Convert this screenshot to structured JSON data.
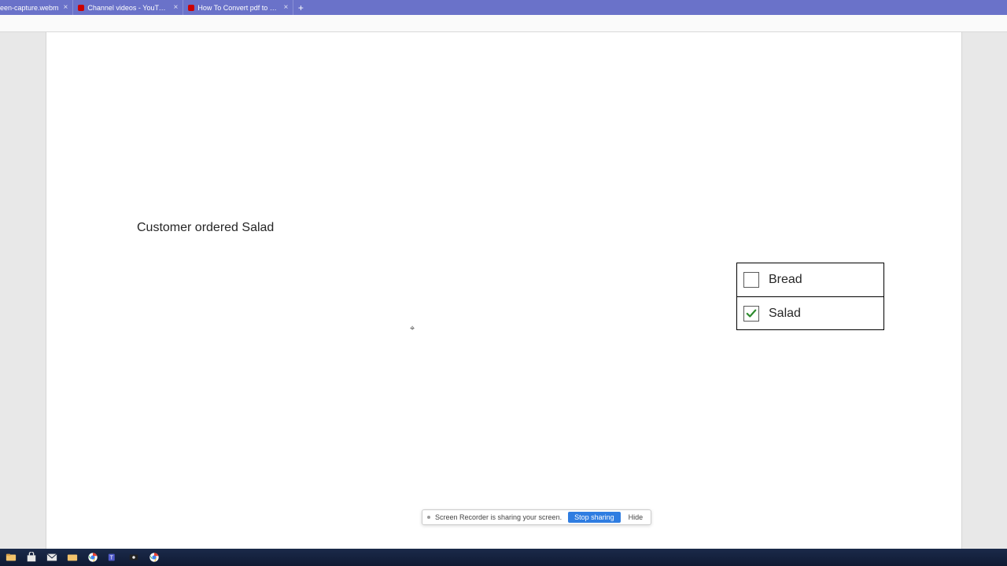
{
  "tabs": [
    {
      "label": "een-capture.webm",
      "has_favicon": false
    },
    {
      "label": "Channel videos - YouTube Studio",
      "has_favicon": true
    },
    {
      "label": "How To Convert pdf to word wit",
      "has_favicon": true
    }
  ],
  "document": {
    "body_text": "Customer ordered Salad",
    "choices": [
      {
        "label": "Bread",
        "checked": false
      },
      {
        "label": "Salad",
        "checked": true
      }
    ]
  },
  "share_bar": {
    "message": "Screen Recorder is sharing your screen.",
    "stop_label": "Stop sharing",
    "hide_label": "Hide"
  },
  "taskbar_icons": [
    "file-explorer-icon",
    "store-icon",
    "mail-icon",
    "folder-icon",
    "chrome-icon",
    "teams-icon",
    "recorder-icon",
    "chrome-icon-2"
  ]
}
